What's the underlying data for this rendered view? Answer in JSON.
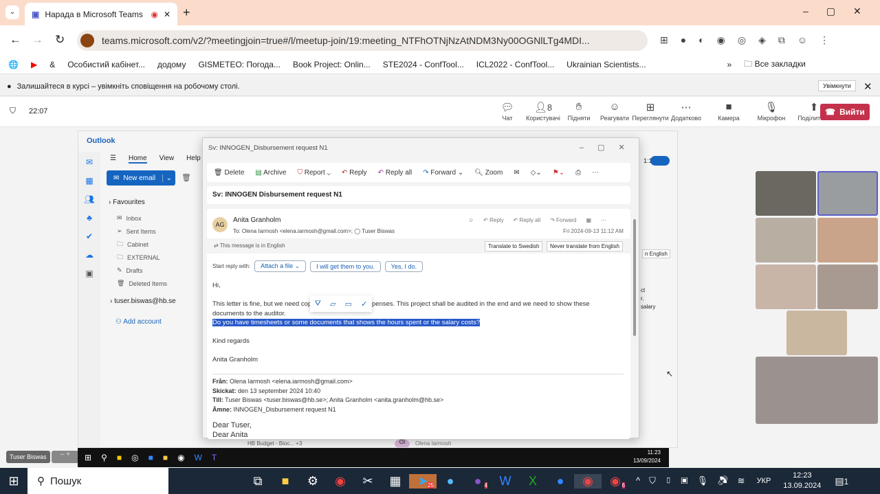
{
  "browser": {
    "tab_title": "Нарада в Microsoft Teams",
    "url": "teams.microsoft.com/v2/?meetingjoin=true#/l/meetup-join/19:meeting_NTFhOTNjNzAtNDM3Ny00OGNlLTg4MDI...",
    "bookmarks": [
      "Особистий кабінет...",
      "додому",
      "GISMETEO: Погода...",
      "Book Project: Onlin...",
      "STE2024 - ConfTool...",
      "ICL2022 - ConfTool...",
      "Ukrainian Scientists..."
    ],
    "all_bookmarks": "Все закладки",
    "info_text": "Залишайтеся в курсі – увімкніть сповіщення на робочому столі.",
    "info_button": "Увімкнути"
  },
  "teams": {
    "time": "22:07",
    "participants_count": "8",
    "buttons": [
      "Чат",
      "Користувачі",
      "Підняти",
      "Реагувати",
      "Переглянути",
      "Додатково",
      "Камера",
      "Мікрофон",
      "Поділитися"
    ],
    "leave": "Вийти",
    "presenter": "Tuser Biswas"
  },
  "outlook": {
    "app": "Outlook",
    "tabs": [
      "Home",
      "View",
      "Help"
    ],
    "new_email": "New email",
    "favourites": "Favourites",
    "folders": [
      "Inbox",
      "Sent Items",
      "Cabinet",
      "EXTERNAL",
      "Drafts",
      "Deleted Items"
    ],
    "account": "tuser.biswas@hb.se",
    "add_account": "Add account",
    "behind": {
      "time": "1:12 AM",
      "translate": "n English",
      "snippet": [
        "ct",
        "r.",
        "salary"
      ],
      "taskbar_item": "HB Budget - Bioc...",
      "plus": "+3",
      "avatar": "OI",
      "sender": "Olena Iarmosh"
    }
  },
  "email": {
    "window_title": "Sv: INNOGEN_Disbursement request N1",
    "toolbar": [
      "Delete",
      "Archive",
      "Report",
      "Reply",
      "Reply all",
      "Forward",
      "Zoom"
    ],
    "subject": "Sv: INNOGEN  Disbursement request N1",
    "avatar": "AG",
    "sender": "Anita Granholm",
    "to": "To:  Olena Iarmosh <elena.iarmosh@gmail.com>;   ◯ Tuser Biswas",
    "actions": [
      "Reply",
      "Reply all",
      "Forward"
    ],
    "date": "Fri 2024-09-13 11:12 AM",
    "lang_note": "This message is in English",
    "translate": "Translate to Swedish",
    "never_translate": "Never translate from English",
    "start_reply": "Start reply with:",
    "suggestions": [
      "Attach a file",
      "I will get them to you.",
      "Yes, I do."
    ],
    "body": {
      "greeting": "Hi,",
      "p1a": "This letter is fine, but we need cop",
      "p1b": "r expenses. This project shall be audited in the end and we need to show these",
      "p1c": "documents to the auditor.",
      "highlight": "Do you have timesheets or some documents that shows the hours spent or the salary costs?",
      "closing": "Kind regards",
      "signature": "Anita Granholm"
    },
    "quoted": {
      "from_label": "Från:",
      "from": " Olena Iarmosh <elena.iarmosh@gmail.com>",
      "sent_label": "Skickat:",
      "sent": " den 13 september 2024 10:40",
      "to_label": "Till:",
      "to": " Tuser Biswas <tuser.biswas@hb.se>; Anita Granholm <anita.granholm@hb.se>",
      "subject_label": "Ämne:",
      "subject": " INNOGEN_Disbursement request N1",
      "l1": "Dear Tuser,",
      "l2": "Dear Anita"
    }
  },
  "remote_taskbar": {
    "time": "11:23",
    "date": "13/09/2024"
  },
  "taskbar": {
    "search": "Пошук",
    "lang": "УКР",
    "time": "12:23",
    "date": "13.09.2024",
    "telegram_badge": "25",
    "viber_badge": "4",
    "chrome_badge": "6",
    "notif": "1"
  }
}
